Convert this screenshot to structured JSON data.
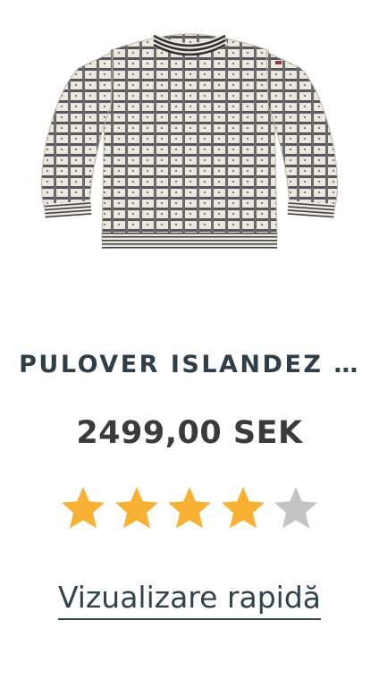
{
  "product": {
    "image_alt": "sweater-image",
    "title": "PULOVER ISLANDEZ …",
    "price": "2499,00 SEK",
    "rating": {
      "value": 4,
      "max": 5,
      "filled_color": "#f8b133",
      "empty_color": "#c4c4c4"
    },
    "quick_view_label": "Vizualizare rapidă"
  },
  "colors": {
    "title": "#2f3f49",
    "price": "#3b3b3b",
    "link": "#31434c"
  }
}
